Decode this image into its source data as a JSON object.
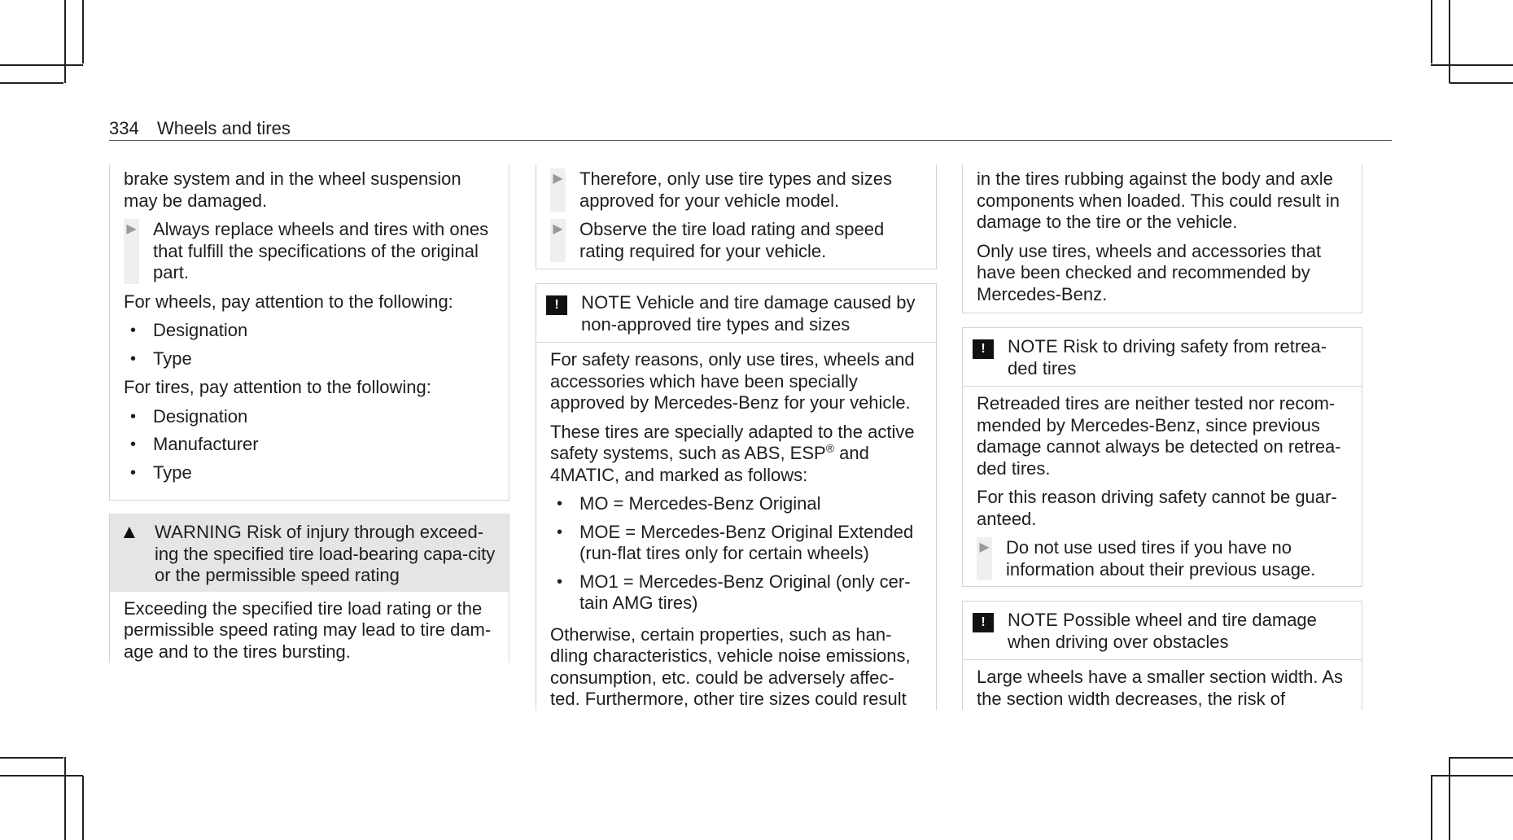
{
  "header": {
    "page_number": "334",
    "section_title": "Wheels and tires"
  },
  "col1": {
    "cont_lines": "brake system and in the wheel suspension may be damaged.",
    "step1": "Always replace wheels and tires with ones that fulfill the specifications of the original part.",
    "wheels_intro": "For wheels, pay attention to the following:",
    "wheels_items": [
      "Designation",
      "Type"
    ],
    "tires_intro": "For tires, pay attention to the following:",
    "tires_items": [
      "Designation",
      "Manufacturer",
      "Type"
    ],
    "warning": {
      "keyword": "WARNING",
      "title": "Risk of injury through exceed-ing the specified tire load-bearing capa-city or the permissible speed rating",
      "body": "Exceeding the specified tire load rating or the permissible speed rating may lead to tire dam-age and to the tires bursting."
    }
  },
  "col2": {
    "step1": "Therefore, only use tire types and sizes approved for your vehicle model.",
    "step2": "Observe the tire load rating and speed rating required for your vehicle.",
    "note": {
      "keyword": "NOTE",
      "title": "Vehicle and tire damage caused by non-approved tire types and sizes",
      "p1": "For safety reasons, only use tires, wheels and accessories which have been specially approved by Mercedes-Benz for your vehicle.",
      "p2_a": "These tires are specially adapted to the active safety systems, such as ABS, ESP",
      "p2_sup": "®",
      "p2_b": " and 4MATIC, and marked as follows:",
      "items": [
        "MO = Mercedes-Benz Original",
        "MOE = Mercedes-Benz Original Extended (run-flat tires only for certain wheels)",
        "MO1 = Mercedes-Benz Original (only cer-tain AMG tires)"
      ],
      "p3": "Otherwise, certain properties, such as han-dling characteristics, vehicle noise emissions, consumption, etc. could be adversely affec-ted. Furthermore, other tire sizes could result"
    }
  },
  "col3": {
    "cont_p1": "in the tires rubbing against the body and axle components when loaded. This could result in damage to the tire or the vehicle.",
    "cont_p2": "Only use tires, wheels and accessories that have been checked and recommended by Mercedes-Benz.",
    "note2": {
      "keyword": "NOTE",
      "title": "Risk to driving safety from retrea-ded tires",
      "p1": "Retreaded tires are neither tested nor recom-mended by Mercedes-Benz, since previous damage cannot always be detected on retrea-ded tires.",
      "p2": "For this reason driving safety cannot be guar-anteed.",
      "step": "Do not use used tires if you have no information about their previous usage."
    },
    "note3": {
      "keyword": "NOTE",
      "title": "Possible wheel and tire damage when driving over obstacles",
      "p1": "Large wheels have a smaller section width. As the section width decreases, the risk of"
    }
  },
  "icons": {
    "step": "triangle-right-icon",
    "note": "exclamation-square-icon",
    "warning": "warning-triangle-icon",
    "bullet": "bullet-dot"
  }
}
